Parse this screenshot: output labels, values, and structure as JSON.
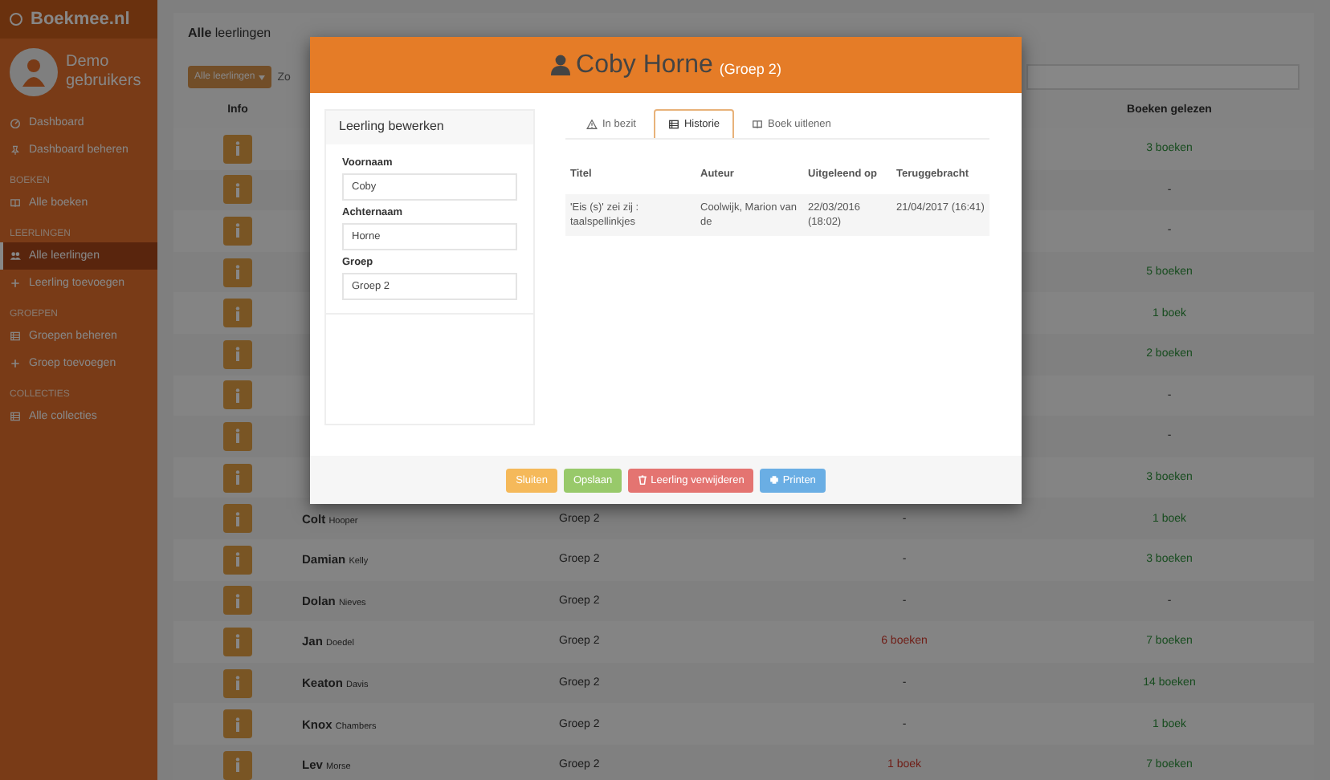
{
  "sidebar": {
    "brand": "Boekmee.nl",
    "user": "Demo gebruikers",
    "sections": [
      {
        "items": [
          {
            "label": "Dashboard",
            "selected": false
          },
          {
            "label": "Dashboard beheren",
            "selected": false
          }
        ]
      },
      {
        "heading": "BOEKEN",
        "items": [
          {
            "label": "Alle boeken",
            "selected": false
          }
        ]
      },
      {
        "heading": "LEERLINGEN",
        "items": [
          {
            "label": "Alle leerlingen",
            "selected": true
          },
          {
            "label": "Leerling toevoegen",
            "selected": false
          }
        ]
      },
      {
        "heading": "GROEPEN",
        "items": [
          {
            "label": "Groepen beheren",
            "selected": false
          },
          {
            "label": "Groep toevoegen",
            "selected": false
          }
        ]
      },
      {
        "heading": "COLLECTIES",
        "items": [
          {
            "label": "Alle collecties",
            "selected": false
          }
        ]
      }
    ]
  },
  "page": {
    "title": "**Alle** leerlingen",
    "filter_button": "Alle leerlingen",
    "toolbar_text": "Zo"
  },
  "table": {
    "columns": {
      "info": "Info",
      "books_read": "Boeken gelezen"
    },
    "rows": [
      {
        "books_read": "3 boeken"
      },
      {
        "books_read": "-"
      },
      {
        "books_read": "-"
      },
      {
        "books_read": "5 boeken"
      },
      {
        "books_read": "1 boek"
      },
      {
        "books_read": "2 boeken"
      },
      {
        "books_read": "-"
      },
      {
        "books_read": "-"
      },
      {
        "books_read": "3 boeken"
      },
      {
        "first_name": "Colt",
        "last_name": "Hooper",
        "group": "Groep 2",
        "column_4": "-",
        "books_read": "1 boek"
      },
      {
        "first_name": "Damian",
        "last_name": "Kelly",
        "group": "Groep 2",
        "column_4": "-",
        "books_read": "3 boeken"
      },
      {
        "first_name": "Dolan",
        "last_name": "Nieves",
        "group": "Groep 2",
        "column_4": "-",
        "books_read": "-"
      },
      {
        "first_name": "Jan",
        "last_name": "Doedel",
        "group": "Groep 2",
        "column_4": "6 boeken",
        "books_read": "7 boeken"
      },
      {
        "first_name": "Keaton",
        "last_name": "Davis",
        "group": "Groep 2",
        "column_4": "-",
        "books_read": "14 boeken"
      },
      {
        "first_name": "Knox",
        "last_name": "Chambers",
        "group": "Groep 2",
        "column_4": "-",
        "books_read": "1 boek"
      },
      {
        "first_name": "Lev",
        "last_name": "Morse",
        "group": "Groep 2",
        "column_4": "1 boek",
        "books_read": "7 boeken"
      }
    ]
  },
  "modal": {
    "title": "Coby Horne",
    "subtitle": "(Groep 2)",
    "edit_panel": {
      "title": "Leerling bewerken",
      "fields": [
        {
          "label": "Voornaam",
          "value": "Coby"
        },
        {
          "label": "Achternaam",
          "value": "Horne"
        },
        {
          "label": "Groep",
          "value": "Groep 2"
        }
      ]
    },
    "tabs": [
      {
        "label": "In bezit",
        "selected": false
      },
      {
        "label": "Historie",
        "selected": true
      },
      {
        "label": "Boek uitlenen",
        "selected": false
      }
    ],
    "history": {
      "columns": [
        "Titel",
        "Auteur",
        "Uitgeleend op",
        "Teruggebracht"
      ],
      "rows": [
        [
          "'Eis (s)' zei zij : taalspellinkjes",
          "Coolwijk, Marion van de",
          "22/03/2016 (18:02)",
          "21/04/2017 (16:41)"
        ]
      ]
    },
    "buttons": [
      {
        "label": "Sluiten",
        "kind": "close"
      },
      {
        "label": "Opslaan",
        "kind": "save"
      },
      {
        "label": "Leerling verwijderen",
        "kind": "delete"
      },
      {
        "label": "Printen",
        "kind": "print"
      }
    ]
  }
}
